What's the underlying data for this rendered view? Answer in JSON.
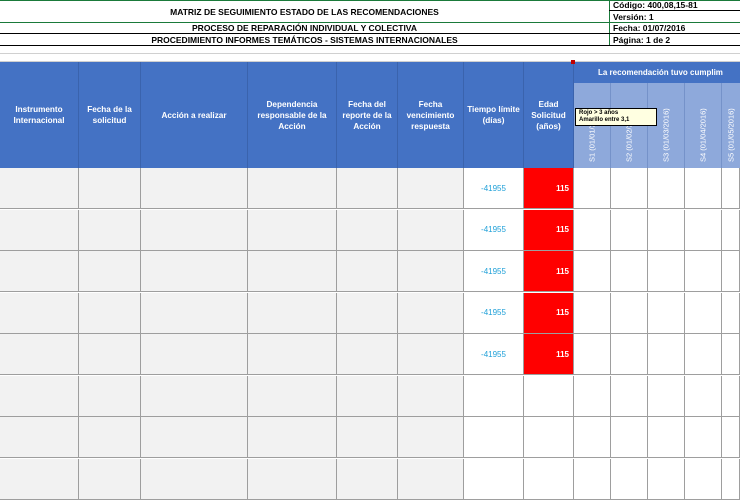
{
  "header": {
    "title1": "MATRIZ DE SEGUIMIENTO ESTADO DE LAS RECOMENDACIONES",
    "title2": "PROCESO DE REPARACIÓN INDIVIDUAL Y COLECTIVA",
    "title3": "PROCEDIMIENTO INFORMES TEMÁTICOS - SISTEMAS INTERNACIONALES",
    "codigo": "Código: 400,08,15-81",
    "version": "Versión: 1",
    "fecha": "Fecha: 01/07/2016",
    "pagina": "Página: 1 de 2"
  },
  "columns": {
    "instrumento": "Instrumento Internacional",
    "fecha_solicitud": "Fecha de la solicitud",
    "accion": "Acción a realizar",
    "dependencia": "Dependencia responsable de la Acción",
    "fecha_reporte": "Fecha del reporte de la Acción",
    "fecha_vencimiento": "Fecha vencimiento respuesta",
    "tiempo": "Tiempo límite (días)",
    "edad": "Edad Solicitud (años)"
  },
  "banner": "La recomendación tuvo cumplim",
  "semester_headers": [
    "S1 (01/01/2016)",
    "S2 (01/02/2016)",
    "S3 (01/03/2016)",
    "S4 (01/04/2016)",
    "S5 (01/05/2016)"
  ],
  "tooltip": {
    "line1": "Rojo > 3 años",
    "line2": "Amarillo entre 3,1"
  },
  "rows": [
    {
      "tiempo": "-41955",
      "edad": "115"
    },
    {
      "tiempo": "-41955",
      "edad": "115"
    },
    {
      "tiempo": "-41955",
      "edad": "115"
    },
    {
      "tiempo": "-41955",
      "edad": "115"
    },
    {
      "tiempo": "-41955",
      "edad": "115"
    },
    {
      "tiempo": "",
      "edad": ""
    },
    {
      "tiempo": "",
      "edad": ""
    },
    {
      "tiempo": "",
      "edad": ""
    }
  ],
  "colors": {
    "header_blue": "#4472c4",
    "header_light_blue": "#8ea9db",
    "edad_red": "#ff0000",
    "tiempo_text": "#1fa0d8",
    "border_green": "#1a7a3a"
  }
}
